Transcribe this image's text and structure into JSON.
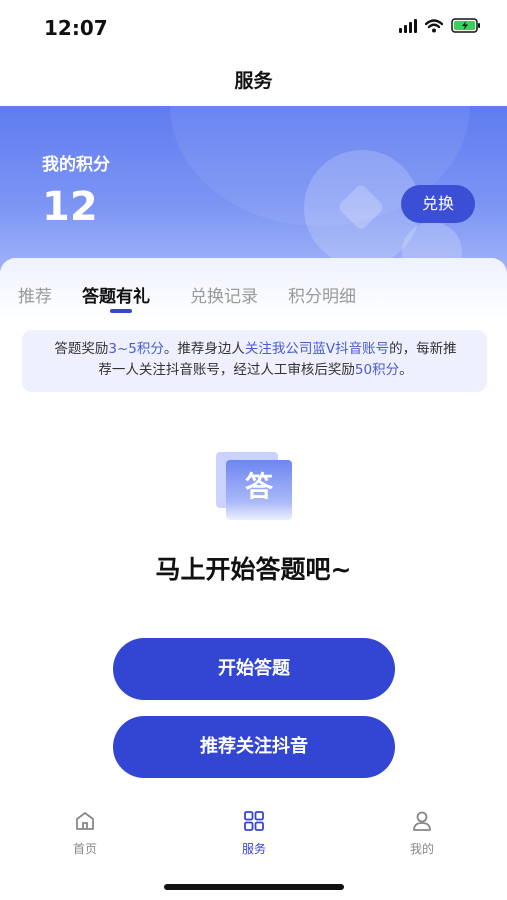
{
  "status_bar": {
    "time": "12:07"
  },
  "nav": {
    "title": "服务"
  },
  "points": {
    "label": "我的积分",
    "value": "12",
    "exchange_label": "兑换"
  },
  "tabs": [
    {
      "label": "推荐"
    },
    {
      "label": "答题有礼"
    },
    {
      "label": "兑换记录"
    },
    {
      "label": "积分明细"
    }
  ],
  "notice": {
    "line1_a": "答题奖励",
    "line1_b": "3~5积分",
    "line1_c": "。推荐身边人",
    "line1_d": "关注我公司蓝V抖音账号",
    "line1_e": "的，每新推",
    "line2_a": "荐一人关注抖音账号，经过人工审核后奖励",
    "line2_b": "50积分",
    "line2_c": "。"
  },
  "badge": {
    "char": "答"
  },
  "prompt": "马上开始答题吧~",
  "buttons": {
    "start": "开始答题",
    "follow": "推荐关注抖音"
  },
  "tab_bar": [
    {
      "label": "首页",
      "icon": "home-icon"
    },
    {
      "label": "服务",
      "icon": "grid-icon"
    },
    {
      "label": "我的",
      "icon": "user-icon"
    }
  ],
  "colors": {
    "accent": "#3346d3",
    "highlight": "#4a5bd6"
  }
}
